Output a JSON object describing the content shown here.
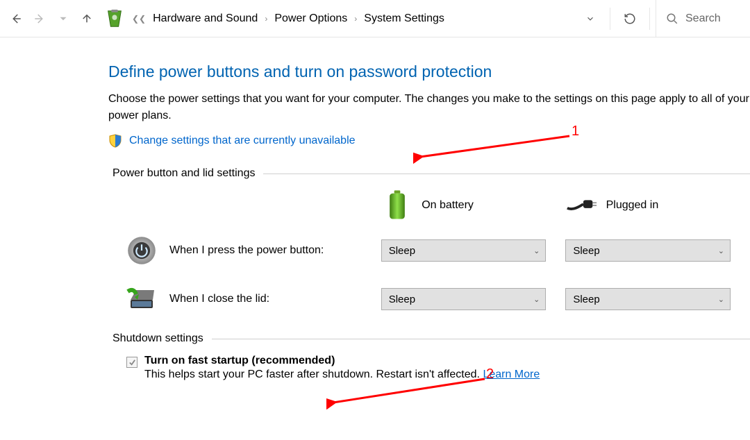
{
  "breadcrumbs": {
    "items": [
      "Hardware and Sound",
      "Power Options",
      "System Settings"
    ]
  },
  "search": {
    "placeholder": "Search"
  },
  "page": {
    "title": "Define power buttons and turn on password protection",
    "description": "Choose the power settings that you want for your computer. The changes you make to the settings on this page apply to all of your power plans.",
    "change_link": "Change settings that are currently unavailable"
  },
  "sections": {
    "power": {
      "heading": "Power button and lid settings",
      "col_battery": "On battery",
      "col_plugged": "Plugged in",
      "rows": [
        {
          "label": "When I press the power button:",
          "battery": "Sleep",
          "plugged": "Sleep"
        },
        {
          "label": "When I close the lid:",
          "battery": "Sleep",
          "plugged": "Sleep"
        }
      ]
    },
    "shutdown": {
      "heading": "Shutdown settings",
      "fast_startup": {
        "label": "Turn on fast startup (recommended)",
        "help": "This helps start your PC faster after shutdown. Restart isn't affected.",
        "learn_more": "Learn More",
        "checked": true
      }
    }
  },
  "annotations": {
    "one": "1",
    "two": "2"
  }
}
